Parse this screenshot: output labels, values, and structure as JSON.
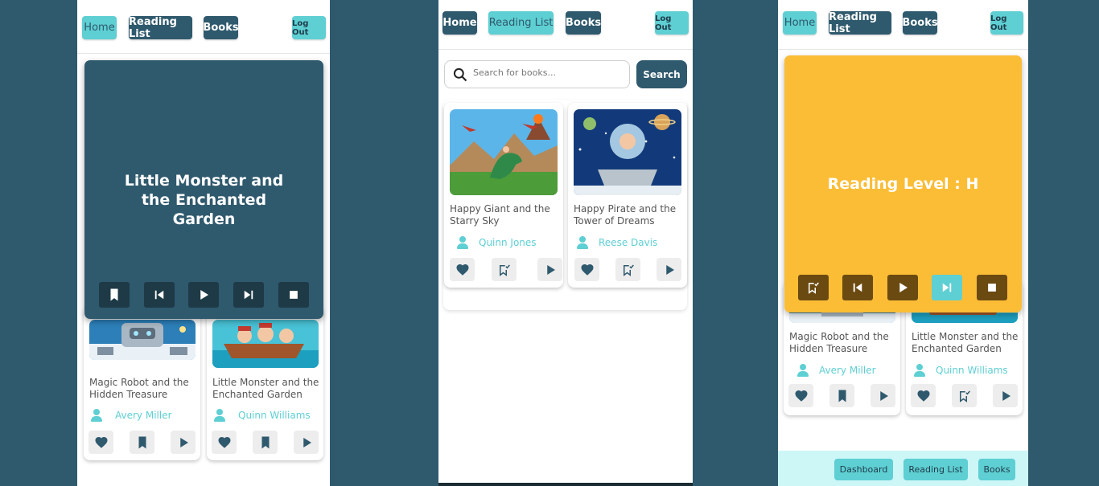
{
  "nav": {
    "home": "Home",
    "reading_list": "Reading List",
    "books": "Books",
    "logout": "Log Out"
  },
  "search": {
    "placeholder": "Search for books...",
    "button": "Search"
  },
  "panel1": {
    "overlay_title": "Little Monster and the Enchanted Garden",
    "books": [
      {
        "title": "Magic Robot and the Hidden Treasure",
        "author": "Avery Miller"
      },
      {
        "title": "Little Monster and the Enchanted Garden",
        "author": "Quinn Williams"
      }
    ]
  },
  "panel2": {
    "books": [
      {
        "title": "Happy Giant and the Starry Sky",
        "author": "Quinn Jones"
      },
      {
        "title": "Happy Pirate and the Tower of Dreams",
        "author": "Reese Davis"
      }
    ]
  },
  "panel3": {
    "overlay_title": "Reading Level : H",
    "books": [
      {
        "title": "Magic Robot and the Hidden Treasure",
        "author": "Avery Miller"
      },
      {
        "title": "Little Monster and the Enchanted Garden",
        "author": "Quinn Williams"
      }
    ],
    "bottom_nav": {
      "dashboard": "Dashboard",
      "reading_list": "Reading List",
      "books": "Books"
    }
  },
  "colors": {
    "background": "#2f596d",
    "accent": "#5ecfd3",
    "dark": "#2f596d",
    "reading_level": "#fbbd36"
  },
  "icons": [
    "heart-icon",
    "bookmark-icon",
    "bookmark-check-icon",
    "play-icon",
    "skip-back-icon",
    "skip-forward-icon",
    "stop-icon",
    "search-icon",
    "person-icon"
  ]
}
